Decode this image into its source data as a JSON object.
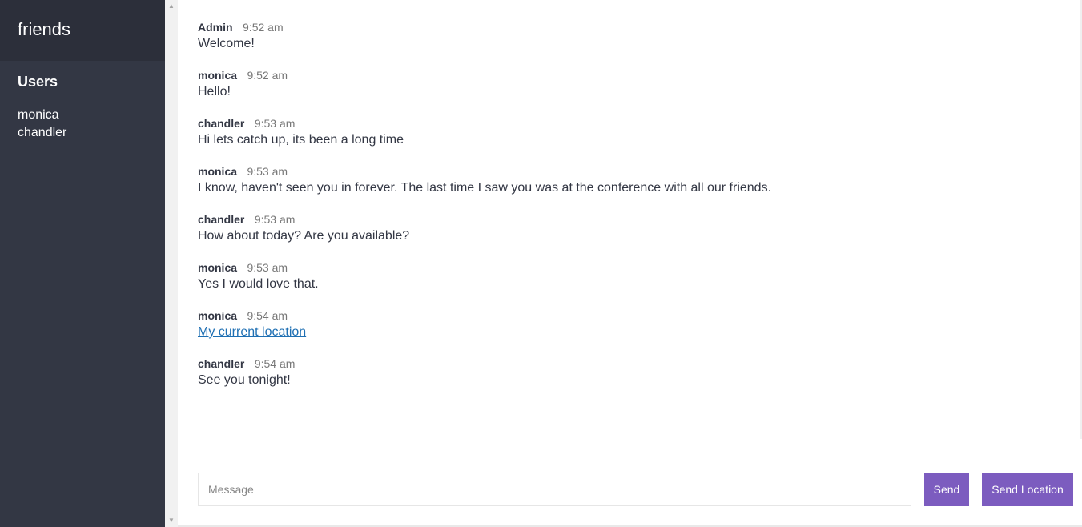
{
  "sidebar": {
    "room_name": "friends",
    "users_title": "Users",
    "users": [
      "monica",
      "chandler"
    ]
  },
  "messages": [
    {
      "name": "Admin",
      "time": "9:52 am",
      "text": "Welcome!"
    },
    {
      "name": "monica",
      "time": "9:52 am",
      "text": "Hello!"
    },
    {
      "name": "chandler",
      "time": "9:53 am",
      "text": "Hi lets catch up, its been a long time"
    },
    {
      "name": "monica",
      "time": "9:53 am",
      "text": "I know, haven't seen you in forever. The last time I saw you was at the conference with all our friends."
    },
    {
      "name": "chandler",
      "time": "9:53 am",
      "text": "How about today? Are you available?"
    },
    {
      "name": "monica",
      "time": "9:53 am",
      "text": "Yes I would love that."
    },
    {
      "name": "monica",
      "time": "9:54 am",
      "link_text": "My current location"
    },
    {
      "name": "chandler",
      "time": "9:54 am",
      "text": "See you tonight!"
    }
  ],
  "compose": {
    "message_placeholder": "Message",
    "message_value": "",
    "send_label": "Send",
    "send_location_label": "Send Location"
  },
  "colors": {
    "sidebar_bg": "#333744",
    "sidebar_header_bg": "#2c2f3a",
    "button_bg": "#7c5cbf",
    "link": "#1e6fb3"
  },
  "icons": {
    "scroll_up": "scroll-up-arrow-icon",
    "scroll_down": "scroll-down-arrow-icon"
  }
}
